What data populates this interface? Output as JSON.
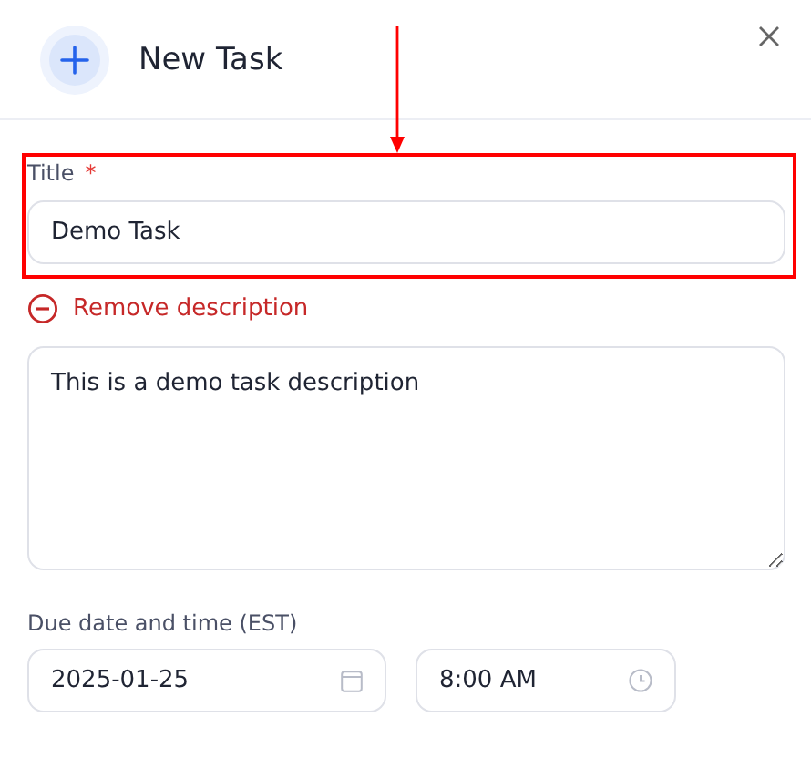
{
  "dialog": {
    "title": "New Task"
  },
  "title_field": {
    "label": "Title",
    "required_mark": "*",
    "value": "Demo Task"
  },
  "remove_description": {
    "label": "Remove description"
  },
  "description": {
    "value": "This is a demo task description"
  },
  "due": {
    "label": "Due date and time (EST)",
    "date": "2025-01-25",
    "time": "8:00 AM"
  }
}
